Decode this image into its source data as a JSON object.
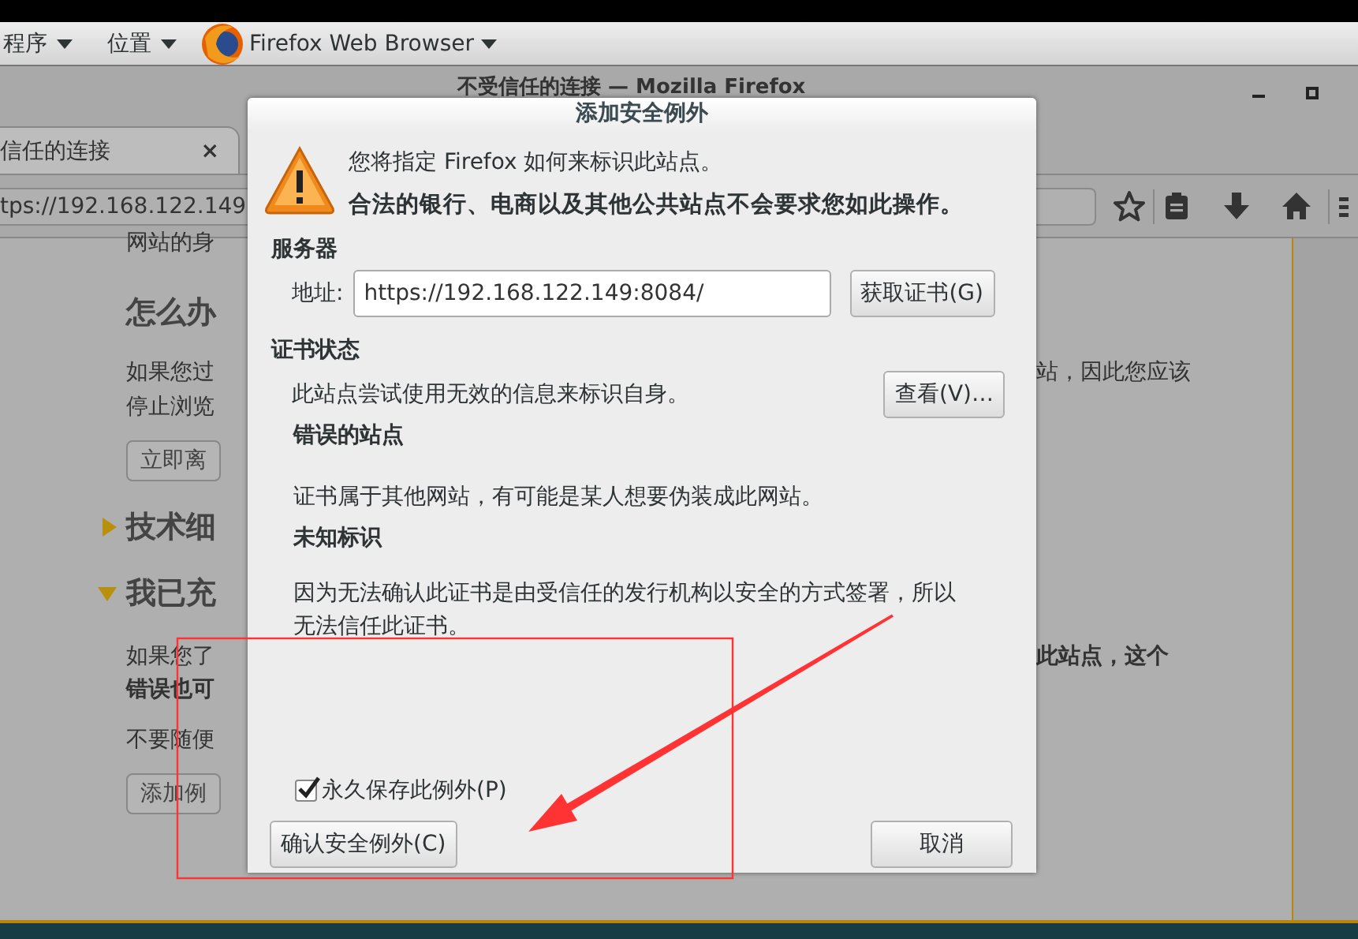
{
  "top_panel": {
    "items": [
      {
        "label": "程序",
        "kind": "menu"
      },
      {
        "label": "位置",
        "kind": "menu"
      },
      {
        "label": "Firefox Web Browser",
        "kind": "app"
      }
    ]
  },
  "browser": {
    "title": "不受信任的连接 — Mozilla Firefox",
    "tab": {
      "label": "信任的连接",
      "close": "×",
      "selected": true
    },
    "url": "tps://192.168.122.149",
    "page_left": [
      {
        "kind": "text",
        "text": "网站的身"
      },
      {
        "kind": "heading",
        "text": "怎么办"
      },
      {
        "kind": "text",
        "text": "如果您过",
        "right": {
          "kind": "text",
          "text": "站，因此您应该"
        }
      },
      {
        "kind": "text",
        "text": "停止浏览"
      },
      {
        "kind": "button",
        "text": "立即离"
      },
      {
        "kind": "section",
        "text": "技术细",
        "expanded": false
      },
      {
        "kind": "section",
        "text": "我已充",
        "expanded": true
      },
      {
        "kind": "text",
        "text": "如果您了",
        "right": {
          "kind": "bold",
          "text": "此站点，这个"
        }
      },
      {
        "kind": "bold",
        "text": "错误也可"
      },
      {
        "kind": "text",
        "text": "不要随便"
      },
      {
        "kind": "button",
        "text": "添加例"
      }
    ]
  },
  "dialog": {
    "title": "添加安全例外",
    "intro": "您将指定 Firefox 如何来标识此站点。",
    "warning": "合法的银行、电商以及其他公共站点不会要求您如此操作。",
    "server_heading": "服务器",
    "address_label": "地址:",
    "address_value": "https://192.168.122.149:8084/",
    "get_cert_button": "获取证书(G)",
    "status_heading": "证书状态",
    "status_text": "此站点尝试使用无效的信息来标识自身。",
    "view_button": "查看(V)…",
    "problems": [
      {
        "heading": "错误的站点",
        "text": "证书属于其他网站，有可能是某人想要伪装成此网站。"
      },
      {
        "heading": "未知标识",
        "text": "因为无法确认此证书是由受信任的发行机构以安全的方式签署，所以无法信任此证书。"
      }
    ],
    "permanent": {
      "label": "永久保存此例外(P)",
      "checked": true
    },
    "confirm_button": "确认安全例外(C)",
    "cancel_button": "取消"
  }
}
